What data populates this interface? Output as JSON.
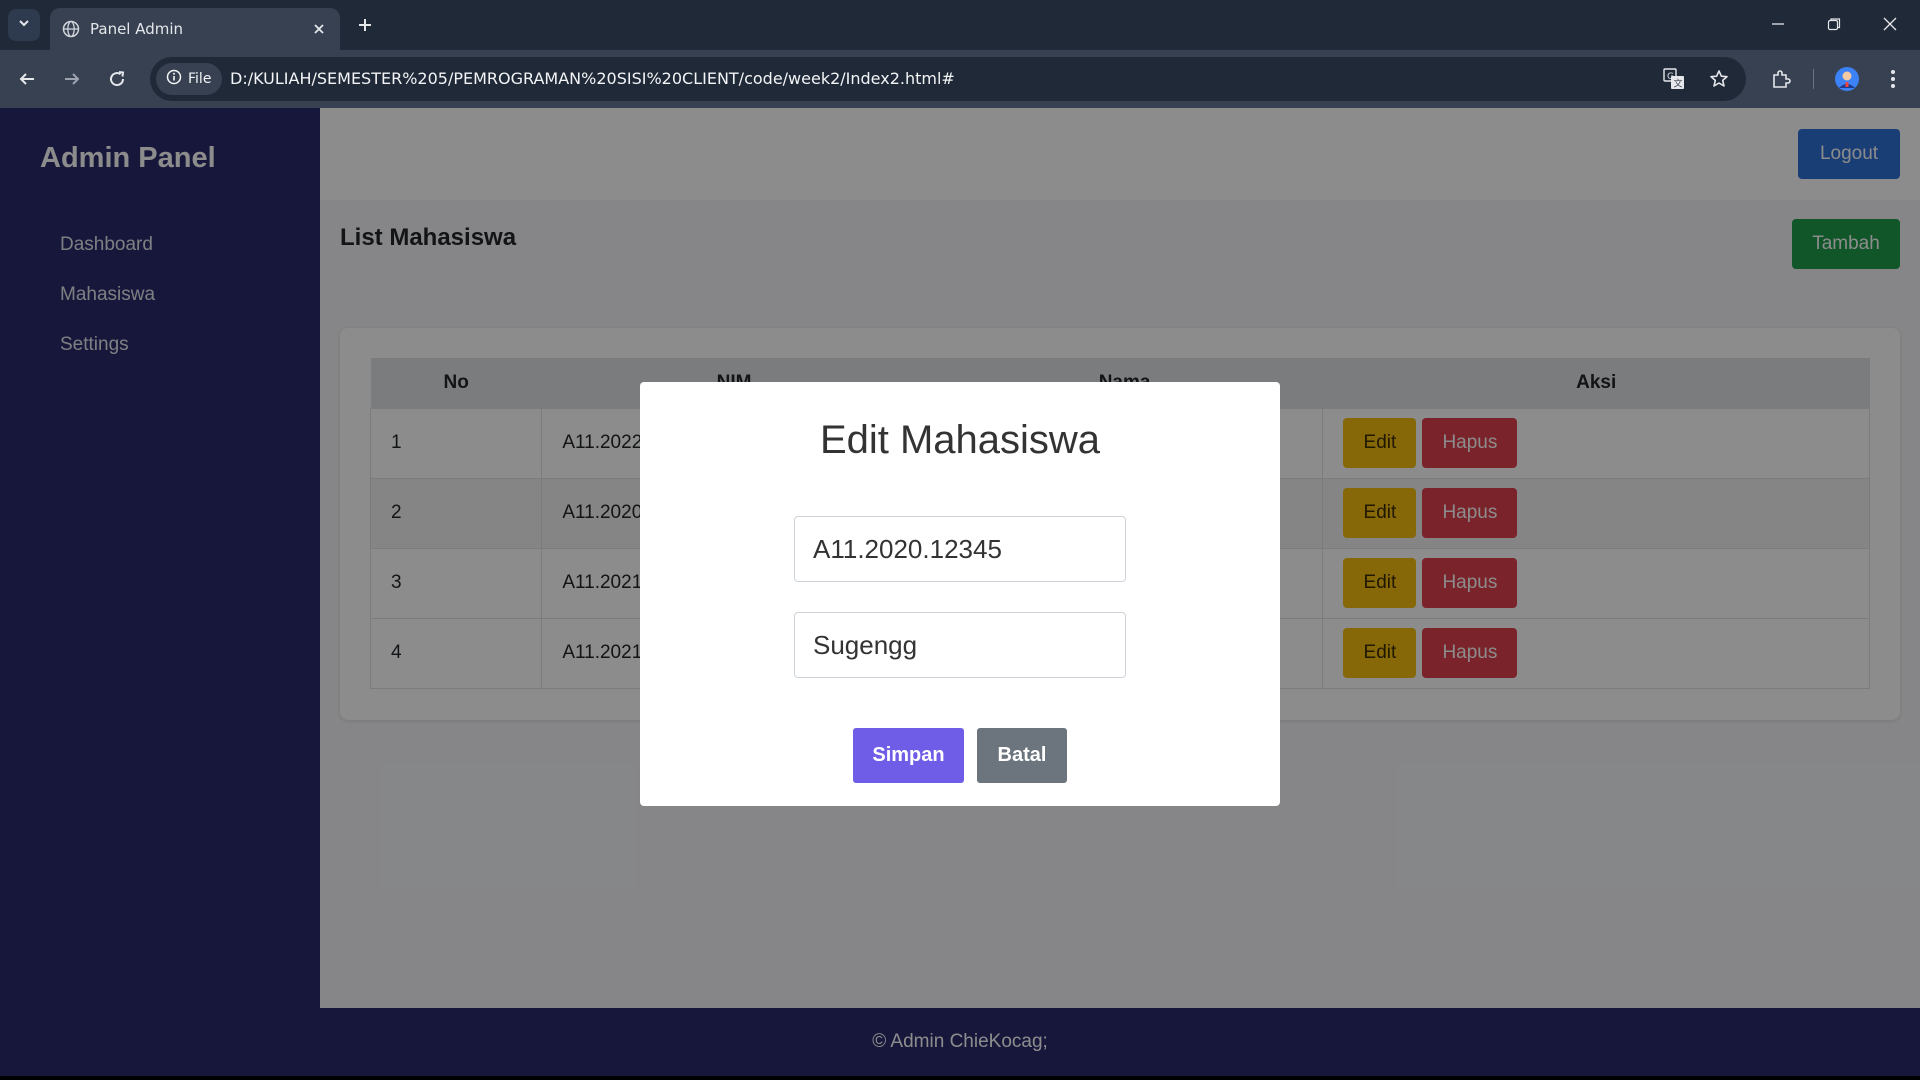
{
  "browser": {
    "tab_title": "Panel Admin",
    "chip_label": "File",
    "url": "D:/KULIAH/SEMESTER%205/PEMROGRAMAN%20SISI%20CLIENT/code/week2/Index2.html#",
    "icons": [
      "tab-search-icon",
      "globe-icon",
      "close-icon",
      "plus-icon",
      "minimize-icon",
      "restore-icon",
      "back-icon",
      "forward-icon",
      "reload-icon",
      "info-icon",
      "translate-icon",
      "star-icon",
      "extensions-icon",
      "profile-avatar",
      "menu-icon"
    ]
  },
  "sidebar": {
    "brand": "Admin Panel",
    "items": [
      {
        "label": "Dashboard"
      },
      {
        "label": "Mahasiswa"
      },
      {
        "label": "Settings"
      }
    ]
  },
  "header": {
    "logout_label": "Logout"
  },
  "content": {
    "title": "List Mahasiswa",
    "add_label": "Tambah",
    "table": {
      "columns": [
        "No",
        "NIM",
        "Nama",
        "Aksi"
      ],
      "rows": [
        {
          "no": "1",
          "nim": "A11.2022"
        },
        {
          "no": "2",
          "nim": "A11.2020"
        },
        {
          "no": "3",
          "nim": "A11.2021"
        },
        {
          "no": "4",
          "nim": "A11.2021"
        }
      ],
      "edit_label": "Edit",
      "delete_label": "Hapus"
    }
  },
  "modal": {
    "title": "Edit Mahasiswa",
    "nim_value": "A11.2020.12345",
    "name_value": "Sugengg",
    "save_label": "Simpan",
    "cancel_label": "Batal"
  },
  "footer": {
    "text": "© Admin ChieKocag;"
  },
  "colors": {
    "sidebar": "#2a2a6e",
    "logout": "#2f6fd6",
    "tambah": "#1f9d4c",
    "edit": "#f5bd11",
    "hapus": "#e0414d",
    "simpan": "#6f5de8",
    "batal": "#6c757d"
  }
}
